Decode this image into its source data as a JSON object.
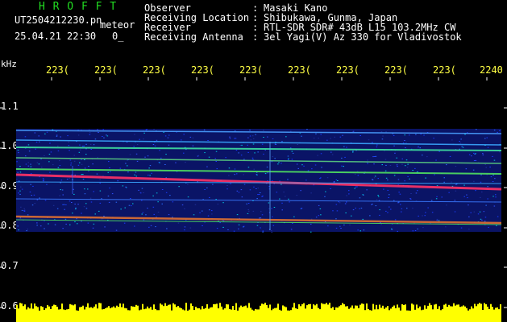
{
  "header": {
    "app_title": "H R O F F T",
    "file_name": "UT2504212230.pn",
    "mode_label": "meteor",
    "timestamp": "25.04.21 22:30",
    "count_value": "0_",
    "info": [
      {
        "key": "Observer",
        "value": "Masaki Kano"
      },
      {
        "key": "Receiving Location",
        "value": "Shibukawa, Gunma, Japan"
      },
      {
        "key": "Receiver",
        "value": "RTL-SDR SDR# 43dB L15 103.2MHz CW"
      },
      {
        "key": "Receiving Antenna",
        "value": "3el Yagi(V) Az 330 for Vladivostok"
      }
    ],
    "separator": ":"
  },
  "axis": {
    "unit": "kHz",
    "time_ticks": [
      "223(",
      "223(",
      "223(",
      "223(",
      "223(",
      "223(",
      "223(",
      "223(",
      "223(",
      "2240"
    ],
    "freq_ticks": [
      "1.1",
      "1.0",
      "0.9",
      "0.8",
      "0.7",
      "0.6"
    ]
  },
  "colors": {
    "background": "#000000",
    "text": "#ffffff",
    "title": "#22dd22",
    "tick": "#ffff44",
    "noise_floor": "#0a1466",
    "signal_line": "#ff3366",
    "bottom_bar": "#ffff00"
  }
}
